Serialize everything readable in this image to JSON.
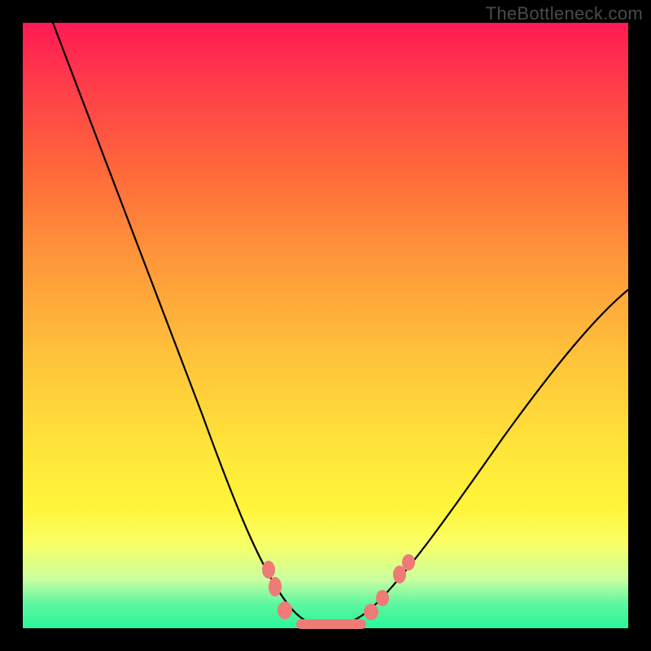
{
  "watermark": "TheBottleneck.com",
  "colors": {
    "frame": "#000000",
    "curve": "#000000",
    "marker": "#ee7b76",
    "gradient_top": "#ff1a53",
    "gradient_bottom": "#2bf59b"
  },
  "chart_data": {
    "type": "line",
    "title": "",
    "xlabel": "",
    "ylabel": "",
    "xlim": [
      0,
      100
    ],
    "ylim": [
      0,
      100
    ],
    "grid": false,
    "legend": false,
    "series": [
      {
        "name": "bottleneck-curve",
        "x": [
          5,
          10,
          15,
          20,
          25,
          30,
          35,
          40,
          43,
          46,
          50,
          54,
          58,
          62,
          66,
          72,
          80,
          90,
          100
        ],
        "y": [
          100,
          88,
          76,
          63,
          50,
          37,
          24,
          11,
          4,
          1,
          0,
          0,
          1,
          4,
          9,
          17,
          28,
          41,
          54
        ]
      }
    ],
    "markers": [
      {
        "x": 40.5,
        "y": 9.5,
        "shape": "round"
      },
      {
        "x": 41.5,
        "y": 6.5,
        "shape": "round"
      },
      {
        "x": 43.0,
        "y": 2.5,
        "shape": "round"
      },
      {
        "x": 47.0,
        "y": 0.3,
        "shape": "bar-left"
      },
      {
        "x": 53.0,
        "y": 0.3,
        "shape": "bar-right"
      },
      {
        "x": 57.0,
        "y": 2.0,
        "shape": "round"
      },
      {
        "x": 59.0,
        "y": 4.5,
        "shape": "round"
      },
      {
        "x": 62.0,
        "y": 8.5,
        "shape": "round"
      },
      {
        "x": 63.5,
        "y": 10.5,
        "shape": "round"
      }
    ],
    "annotations": []
  }
}
